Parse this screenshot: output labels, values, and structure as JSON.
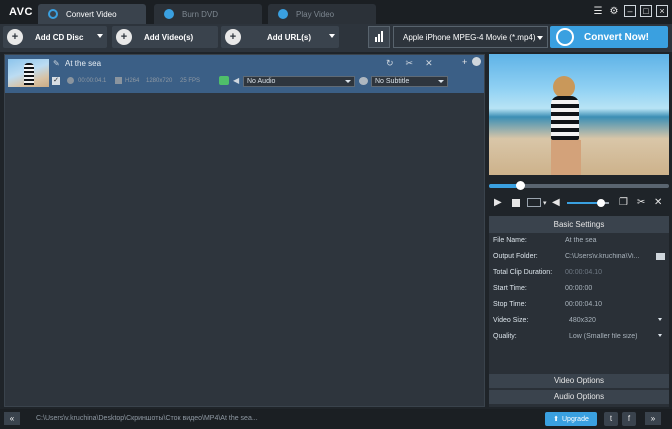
{
  "app": {
    "logo": "AVC"
  },
  "tabs": [
    {
      "label": "Convert Video",
      "active": true,
      "icon": "convert-icon"
    },
    {
      "label": "Burn DVD",
      "active": false,
      "icon": "disc-icon"
    },
    {
      "label": "Play Video",
      "active": false,
      "icon": "play-icon"
    }
  ],
  "window_controls": {
    "menu_icon": "list-icon",
    "settings_icon": "gear-icon",
    "minimize": "–",
    "maximize": "□",
    "close": "×"
  },
  "toolbar": {
    "add_cd": "Add CD Disc",
    "add_video": "Add Video(s)",
    "add_url": "Add URL(s)",
    "profile": "Apple iPhone MPEG-4 Movie (*.mp4)",
    "convert": "Convert Now!"
  },
  "file": {
    "title": "At the sea",
    "duration": "00:00:04.1",
    "codec": "H264",
    "resolution": "1280x720",
    "fps": "25 FPS",
    "audio_select": "No Audio",
    "subtitle_select": "No Subtitle",
    "checked": true
  },
  "player": {
    "seek_fraction": 0.17,
    "volume_fraction": 0.8
  },
  "settings": {
    "header": "Basic Settings",
    "rows": [
      {
        "key": "File Name:",
        "value": "At the sea"
      },
      {
        "key": "Output Folder:",
        "value": "C:\\Users\\v.kruchina\\Vi..."
      },
      {
        "key": "Total Clip Duration:",
        "value": "00:00:04.10"
      },
      {
        "key": "Start Time:",
        "value": "00:00:00"
      },
      {
        "key": "Stop Time:",
        "value": "00:00:04.10"
      },
      {
        "key": "Video Size:",
        "value": "480x320"
      },
      {
        "key": "Quality:",
        "value": "Low (Smaller file size)"
      }
    ],
    "video_options": "Video Options",
    "audio_options": "Audio Options"
  },
  "statusbar": {
    "collapse": "«",
    "path": "C:\\Users\\v.kruchina\\Desktop\\Скриншоты\\Сток видео\\MP4\\At the sea...",
    "upgrade": "Upgrade",
    "twitter": "t",
    "facebook": "f",
    "expand": "»"
  },
  "colors": {
    "accent": "#3aa0e0",
    "background": "#1f2429",
    "panel": "#2e353d",
    "selected_row": "#3b5f86"
  }
}
